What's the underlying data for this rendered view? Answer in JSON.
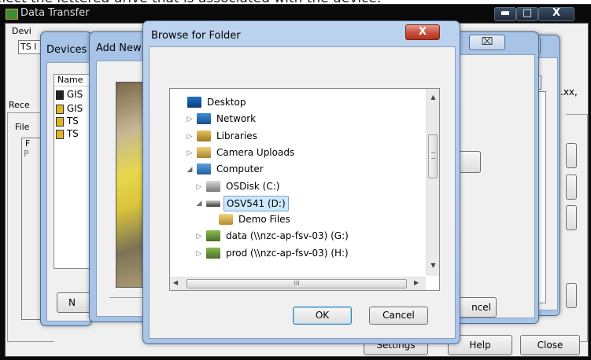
{
  "caption": "elect the lettered drive that is associated with the device.",
  "data_transfer": {
    "title": "Data Transfer",
    "device_group_label": "Devi",
    "device_value": "TS I",
    "receive_tab": "Rece",
    "file_group_label": "File",
    "list_header_partial": "F",
    "list_row_partial": "P",
    "file_types_fragment": ".xx,",
    "buttons": {
      "settings": "Settings",
      "help": "Help",
      "close": "Close"
    }
  },
  "devices_dialog": {
    "title": "Devices",
    "column_name": "Name",
    "items": [
      "GIS",
      "GIS",
      "TS",
      "TS"
    ],
    "button_partial": "N"
  },
  "add_new_dialog": {
    "title": "Add New",
    "cancel_partial": "ncel"
  },
  "browse_dialog": {
    "title": "Browse for Folder",
    "close_glyph": "X",
    "tree": [
      {
        "label": "Desktop",
        "icon": "desktop-icon",
        "expander": "none",
        "level": 0
      },
      {
        "label": "Network",
        "icon": "network-icon",
        "expander": "collapsed",
        "level": 1
      },
      {
        "label": "Libraries",
        "icon": "libraries-icon",
        "expander": "collapsed",
        "level": 1
      },
      {
        "label": "Camera Uploads",
        "icon": "folder-special-icon",
        "expander": "collapsed",
        "level": 1
      },
      {
        "label": "Computer",
        "icon": "computer-icon",
        "expander": "expanded",
        "level": 1
      },
      {
        "label": "OSDisk (C:)",
        "icon": "system-drive-icon",
        "expander": "collapsed",
        "level": 2
      },
      {
        "label": "OSV541 (D:)",
        "icon": "removable-drive-icon",
        "expander": "expanded",
        "level": 2,
        "selected": true
      },
      {
        "label": "Demo Files",
        "icon": "folder-icon",
        "expander": "none",
        "level": 3
      },
      {
        "label": "data (\\\\nzc-ap-fsv-03) (G:)",
        "icon": "network-drive-icon",
        "expander": "collapsed",
        "level": 2
      },
      {
        "label": "prod (\\\\nzc-ap-fsv-03) (H:)",
        "icon": "network-drive-icon",
        "expander": "collapsed",
        "level": 2
      }
    ],
    "hscroll_grip": "III",
    "ok_label": "OK",
    "cancel_label": "Cancel"
  },
  "colors": {
    "selection": "#cce8ff",
    "selection_border": "#7da2ce",
    "close_red": "#c75050",
    "aero": "#a7c3e6"
  }
}
